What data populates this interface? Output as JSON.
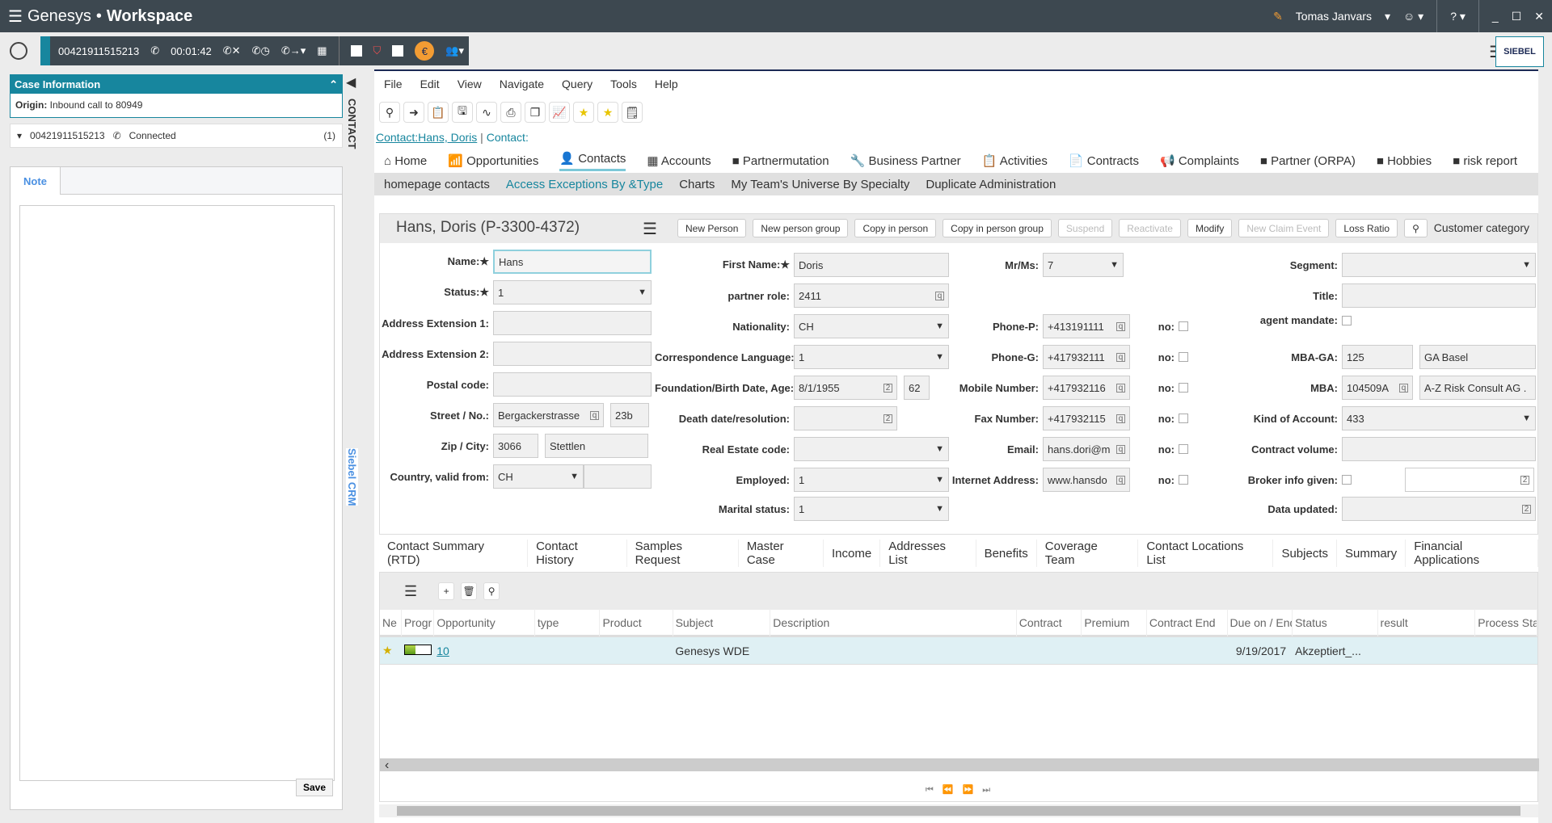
{
  "titlebar": {
    "brand": "Genesys",
    "app": "Workspace",
    "user": "Tomas Janvars",
    "icons": [
      "agent-status-icon",
      "headset-icon",
      "help-icon",
      "minimize-icon",
      "maximize-icon",
      "close-icon"
    ]
  },
  "callbar": {
    "number": "00421911515213",
    "timer": "00:01:42",
    "icons": [
      "phone-icon",
      "hangup-icon",
      "hold-icon",
      "transfer-icon",
      "keypad-icon",
      "disposition-icon",
      "currency-icon",
      "consult-icon"
    ]
  },
  "case": {
    "title": "Case Information",
    "origin_label": "Origin:",
    "origin_value": "Inbound call to 80949",
    "call_number": "00421911515213",
    "call_status": "Connected",
    "badge": "(1)"
  },
  "note": {
    "tab": "Note",
    "text": "",
    "save": "Save"
  },
  "side": {
    "contact": "CONTACT",
    "siebel": "Siebel CRM"
  },
  "siebel": {
    "menu": [
      "File",
      "Edit",
      "View",
      "Navigate",
      "Query",
      "Tools",
      "Help"
    ],
    "toolbar_icons": [
      "search-icon",
      "go-icon",
      "clipboard-check-icon",
      "save-icon",
      "link-icon",
      "print-icon",
      "copy-icon",
      "chart-icon",
      "star-icon",
      "add-favorite-icon",
      "notes-icon"
    ],
    "crumb_link": "Contact:Hans, Doris",
    "crumb_sep": "|",
    "crumb_current": "Contact:",
    "nav_tabs": [
      "Home",
      "Opportunities",
      "Contacts",
      "Accounts",
      "Partnermutation",
      "Business Partner",
      "Activities",
      "Contracts",
      "Complaints",
      "Partner (ORPA)",
      "Hobbies",
      "risk report"
    ],
    "active_nav": "Contacts",
    "sub_nav": [
      "homepage contacts",
      "Access Exceptions By &Type",
      "Charts",
      "My Team's Universe By Specialty",
      "Duplicate Administration"
    ],
    "active_sub": "Access Exceptions By &Type"
  },
  "form": {
    "title": "Hans, Doris (P-3300-4372)",
    "buttons": [
      {
        "label": "New Person",
        "enabled": true
      },
      {
        "label": "New person group",
        "enabled": true
      },
      {
        "label": "Copy in person",
        "enabled": true
      },
      {
        "label": "Copy in person group",
        "enabled": true
      },
      {
        "label": "Suspend",
        "enabled": false
      },
      {
        "label": "Reactivate",
        "enabled": false
      },
      {
        "label": "Modify",
        "enabled": true
      },
      {
        "label": "New Claim Event",
        "enabled": false
      },
      {
        "label": "Loss Ratio",
        "enabled": true
      }
    ],
    "customer_category": "Customer category",
    "fields": {
      "name": {
        "label": "Name:",
        "value": "Hans"
      },
      "status": {
        "label": "Status:",
        "value": "1"
      },
      "addr1": {
        "label": "Address Extension 1:",
        "value": ""
      },
      "addr2": {
        "label": "Address Extension 2:",
        "value": ""
      },
      "postal": {
        "label": "Postal code:",
        "value": ""
      },
      "street": {
        "label": "Street / No.:",
        "value": "Bergackerstrasse",
        "no": "23b"
      },
      "zip": {
        "label": "Zip / City:",
        "value": "3066",
        "city": "Stettlen"
      },
      "country": {
        "label": "Country, valid from:",
        "value": "CH",
        "from": ""
      },
      "first": {
        "label": "First Name:",
        "value": "Doris"
      },
      "role": {
        "label": "partner role:",
        "value": "2411"
      },
      "nationality": {
        "label": "Nationality:",
        "value": "CH"
      },
      "lang": {
        "label": "Correspondence Language:",
        "value": "1"
      },
      "birth": {
        "label": "Foundation/Birth Date, Age:",
        "value": "8/1/1955",
        "age": "62"
      },
      "death": {
        "label": "Death date/resolution:",
        "value": ""
      },
      "realestate": {
        "label": "Real Estate code:",
        "value": ""
      },
      "employed": {
        "label": "Employed:",
        "value": "1"
      },
      "marital": {
        "label": "Marital status:",
        "value": "1"
      },
      "mrms": {
        "label": "Mr/Ms:",
        "value": "7"
      },
      "phonep": {
        "label": "Phone-P:",
        "value": "+413191111"
      },
      "phoneg": {
        "label": "Phone-G:",
        "value": "+417932111"
      },
      "mobile": {
        "label": "Mobile Number:",
        "value": "+417932116"
      },
      "fax": {
        "label": "Fax Number:",
        "value": "+417932115"
      },
      "email": {
        "label": "Email:",
        "value": "hans.dori@m"
      },
      "internet": {
        "label": "Internet Address:",
        "value": "www.hansdo"
      },
      "no_label": "no:",
      "segment": {
        "label": "Segment:",
        "value": ""
      },
      "title": {
        "label": "Title:",
        "value": ""
      },
      "agent": {
        "label": "agent mandate:"
      },
      "mbaga": {
        "label": "MBA-GA:",
        "value": "125",
        "name": "GA Basel"
      },
      "mba": {
        "label": "MBA:",
        "value": "104509A",
        "name": "A-Z Risk Consult AG ."
      },
      "kind": {
        "label": "Kind of Account:",
        "value": "433"
      },
      "volume": {
        "label": "Contract volume:",
        "value": ""
      },
      "broker": {
        "label": "Broker info given:",
        "date": ""
      },
      "updated": {
        "label": "Data updated:",
        "value": ""
      }
    }
  },
  "child_tabs": [
    "Contact Summary (RTD)",
    "Contact History",
    "Samples Request",
    "Master Case",
    "Income",
    "Addresses List",
    "Benefits",
    "Coverage Team",
    "Contact Locations List",
    "Subjects",
    "Summary",
    "Financial Applications"
  ],
  "list": {
    "columns": [
      "Ne",
      "Progr",
      "Opportunity",
      "type",
      "Product",
      "Subject",
      "Description",
      "Contract",
      "Premium",
      "Contract End",
      "Due on / End",
      "Status",
      "result",
      "Process Sta"
    ],
    "rows": [
      {
        "progress": 0.4,
        "opportunity": "10",
        "type": "",
        "product": "",
        "subject": "Genesys WDE",
        "description": "",
        "contract": "",
        "premium": "",
        "contract_end": "",
        "due": "9/19/2017",
        "status": "Akzeptiert_...",
        "result": "",
        "process": ""
      }
    ]
  }
}
